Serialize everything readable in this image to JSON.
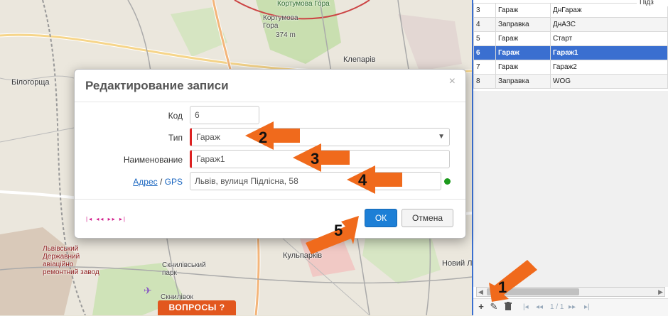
{
  "map": {
    "labels": {
      "kortumova": "Кортумова Гора",
      "kortumova_mid": "Кортумова Гора",
      "kortumova_elev": "374 m",
      "bilogorshcha": "Білогорща",
      "kleparov": "Клепарів",
      "kulparkiv": "Кульпарків",
      "sknylivsky": "Скнилівський парк",
      "novyi": "Новий Л",
      "sknyliv": "Скнилівок",
      "aviation": "Львівський Державний авіаційно ремонтний завод"
    },
    "questions_button": "ВОПРОСЫ ?"
  },
  "grid": {
    "top_fragment": "Підз",
    "rows": [
      {
        "num": "3",
        "type": "Гараж",
        "name": "ДнГараж"
      },
      {
        "num": "4",
        "type": "Заправка",
        "name": "ДнАЗС"
      },
      {
        "num": "5",
        "type": "Гараж",
        "name": "Старт"
      },
      {
        "num": "6",
        "type": "Гараж",
        "name": "Гараж1"
      },
      {
        "num": "7",
        "type": "Гараж",
        "name": "Гараж2"
      },
      {
        "num": "8",
        "type": "Заправка",
        "name": "WOG"
      }
    ],
    "selected_num": "6",
    "pager": {
      "page": "1 / 1",
      "first": "|◂",
      "prev": "◂◂",
      "next": "▸▸",
      "last": "▸|"
    },
    "icons": {
      "add": "plus-icon",
      "edit": "pencil-icon",
      "delete": "trash-icon"
    }
  },
  "dialog": {
    "title": "Редактирование записи",
    "close": "×",
    "fields": {
      "code_label": "Код",
      "code_value": "6",
      "type_label": "Тип",
      "type_value": "Гараж",
      "name_label": "Наименование",
      "name_value": "Гараж1",
      "address_link": "Адрес",
      "separator": " / ",
      "gps_link": "GPS",
      "address_value": "Львів, вулиця Підлісна, 58"
    },
    "nav_arrows": "|◂ ◂◂ ▸▸ ▸|",
    "ok": "ОК",
    "cancel": "Отмена"
  },
  "callouts": [
    "1",
    "2",
    "3",
    "4",
    "5"
  ],
  "colors": {
    "accent": "#f06a1c",
    "selection": "#3a6fd0",
    "ok_button": "#1d7fd6",
    "status_ok": "#1c9a1c"
  }
}
